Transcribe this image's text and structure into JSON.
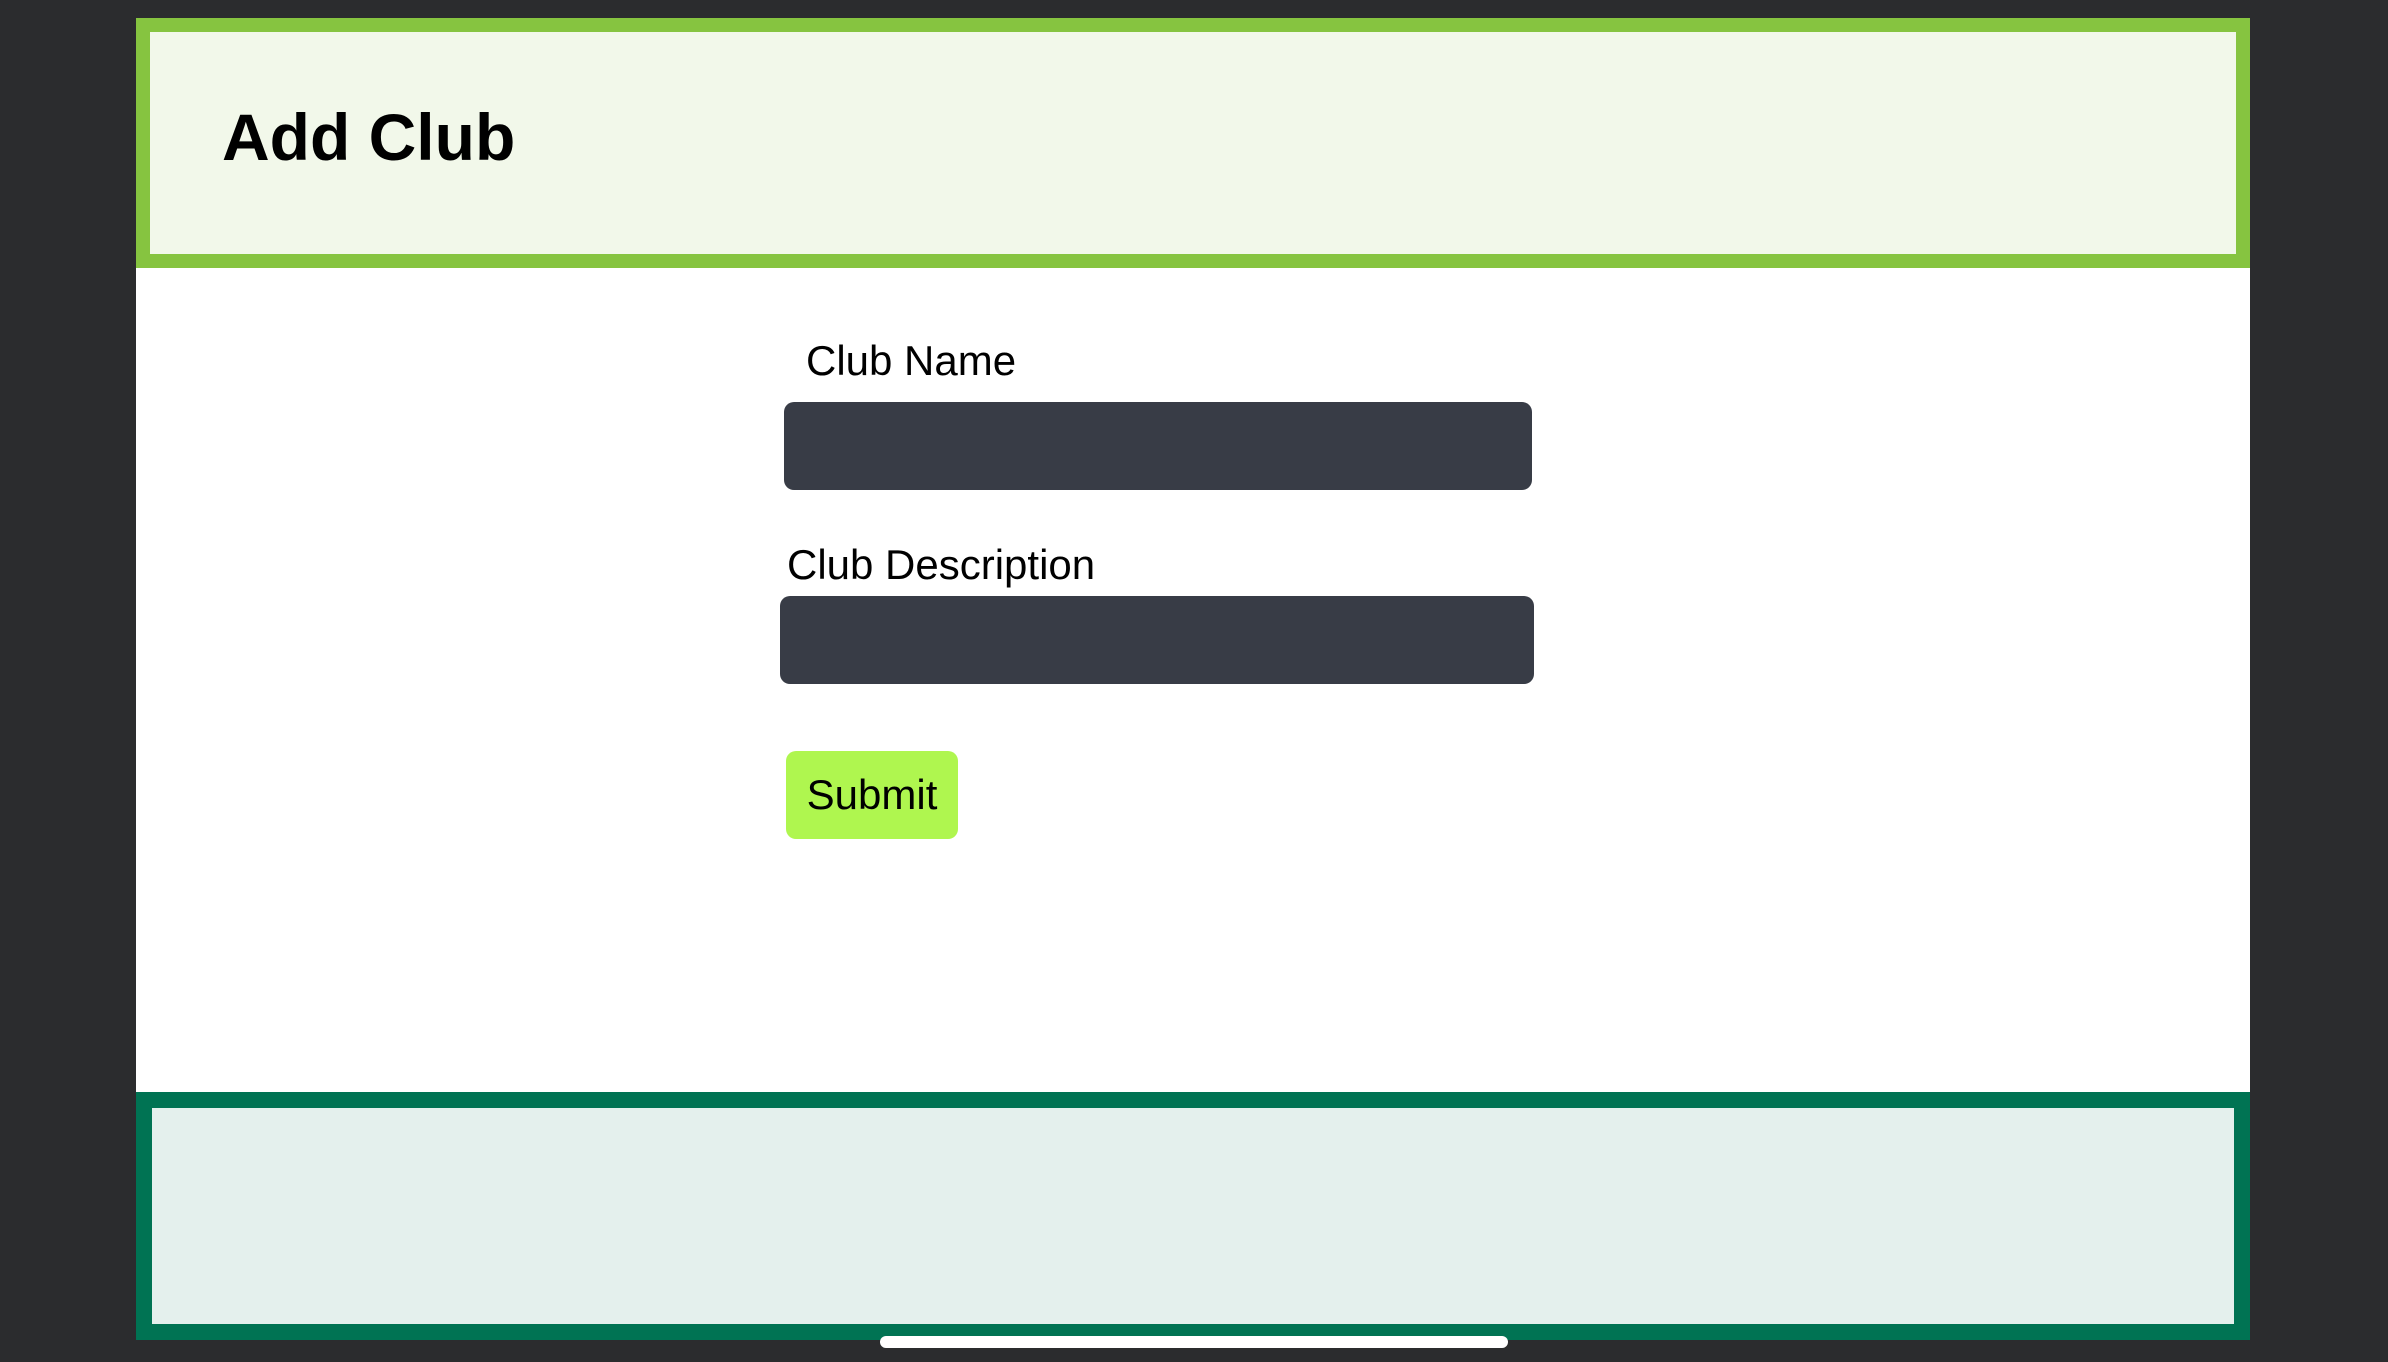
{
  "header": {
    "title": "Add Club"
  },
  "form": {
    "club_name_label": "Club Name",
    "club_name_value": "",
    "club_description_label": "Club Description",
    "club_description_value": "",
    "submit_label": "Submit"
  },
  "colors": {
    "header_border": "#86c440",
    "header_background": "#f2f8ea",
    "input_background": "#383c46",
    "submit_background": "#aff64f",
    "footer_border": "#007353",
    "footer_background": "#e4f0ed",
    "outer_background": "#2b2c2e"
  }
}
